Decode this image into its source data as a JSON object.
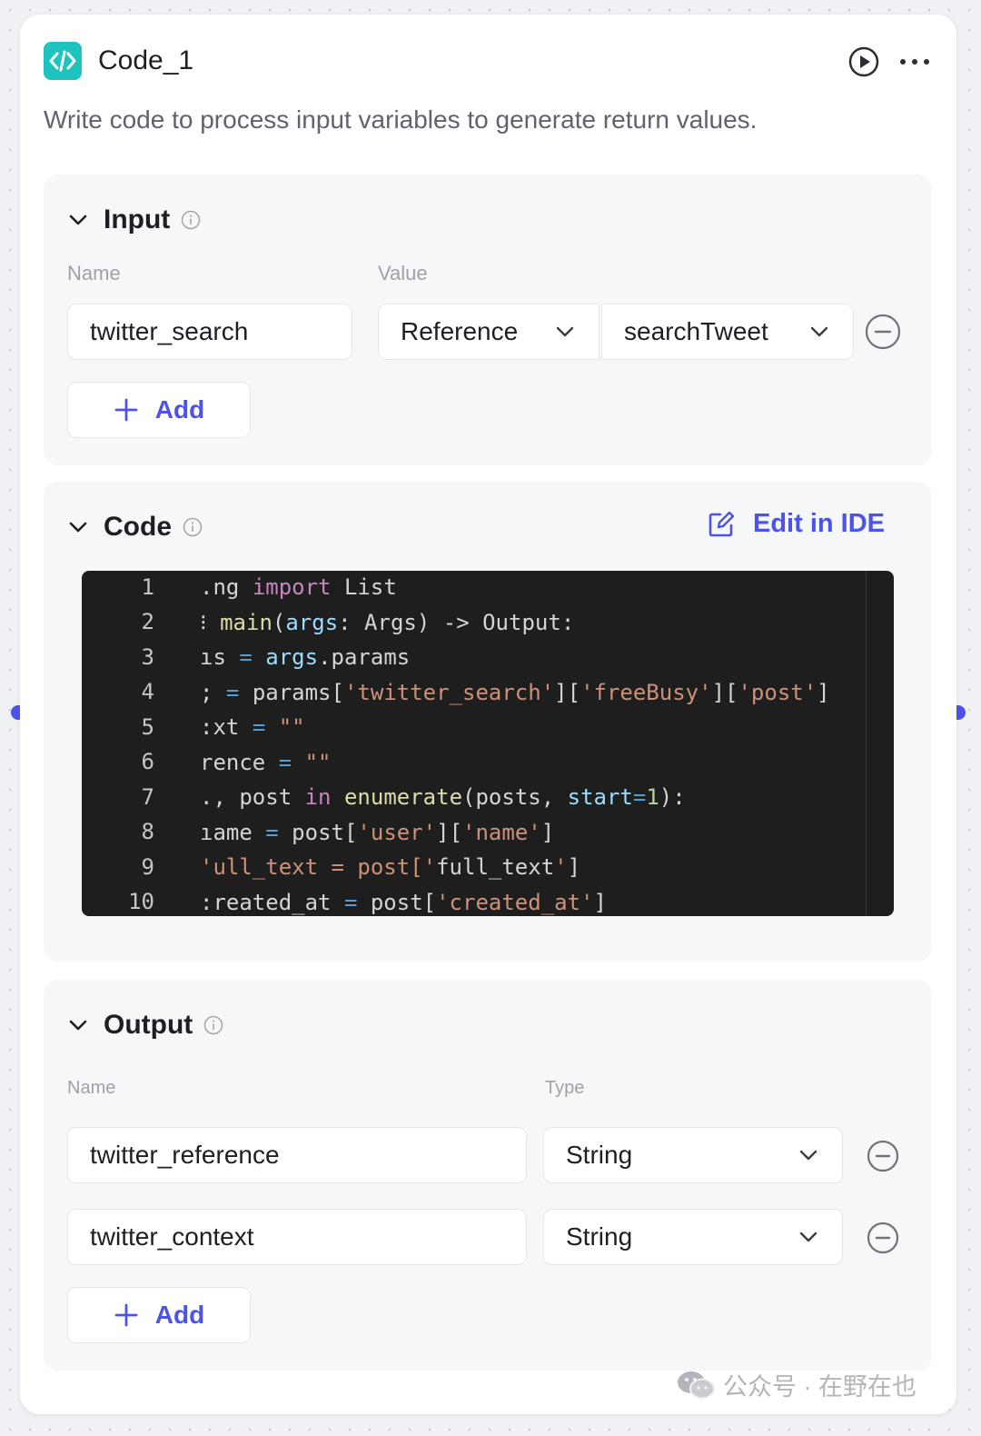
{
  "node": {
    "title": "Code_1",
    "description": "Write code to process input variables to generate return values.",
    "icon": "code-icon"
  },
  "input": {
    "title": "Input",
    "name_label": "Name",
    "value_label": "Value",
    "rows": [
      {
        "name": "twitter_search",
        "value_type": "Reference",
        "reference": "searchTweet"
      }
    ],
    "add_label": "Add"
  },
  "code": {
    "title": "Code",
    "edit_label": "Edit in IDE",
    "line_numbers": [
      "1",
      "2",
      "3",
      "4",
      "5",
      "6",
      "7",
      "8",
      "9",
      "10"
    ],
    "lines": [
      ".ng import List",
      "⁝ main(args: Args) -> Output:",
      "ıs = args.params",
      "; = params['twitter_search']['freeBusy']['post']",
      ":xt = \"\"",
      "rence = \"\"",
      "., post in enumerate(posts, start=1):",
      "ıame = post['user']['name']",
      "'ull_text = post['full_text']",
      ":reated_at = post['created_at']"
    ]
  },
  "output": {
    "title": "Output",
    "name_label": "Name",
    "type_label": "Type",
    "rows": [
      {
        "name": "twitter_reference",
        "type": "String"
      },
      {
        "name": "twitter_context",
        "type": "String"
      }
    ],
    "add_label": "Add"
  },
  "watermark": {
    "text": "公众号 · 在野在也"
  },
  "colors": {
    "accent": "#4d53e8",
    "node_icon": "#1fc4c0",
    "editor_bg": "#1e1e1e"
  }
}
